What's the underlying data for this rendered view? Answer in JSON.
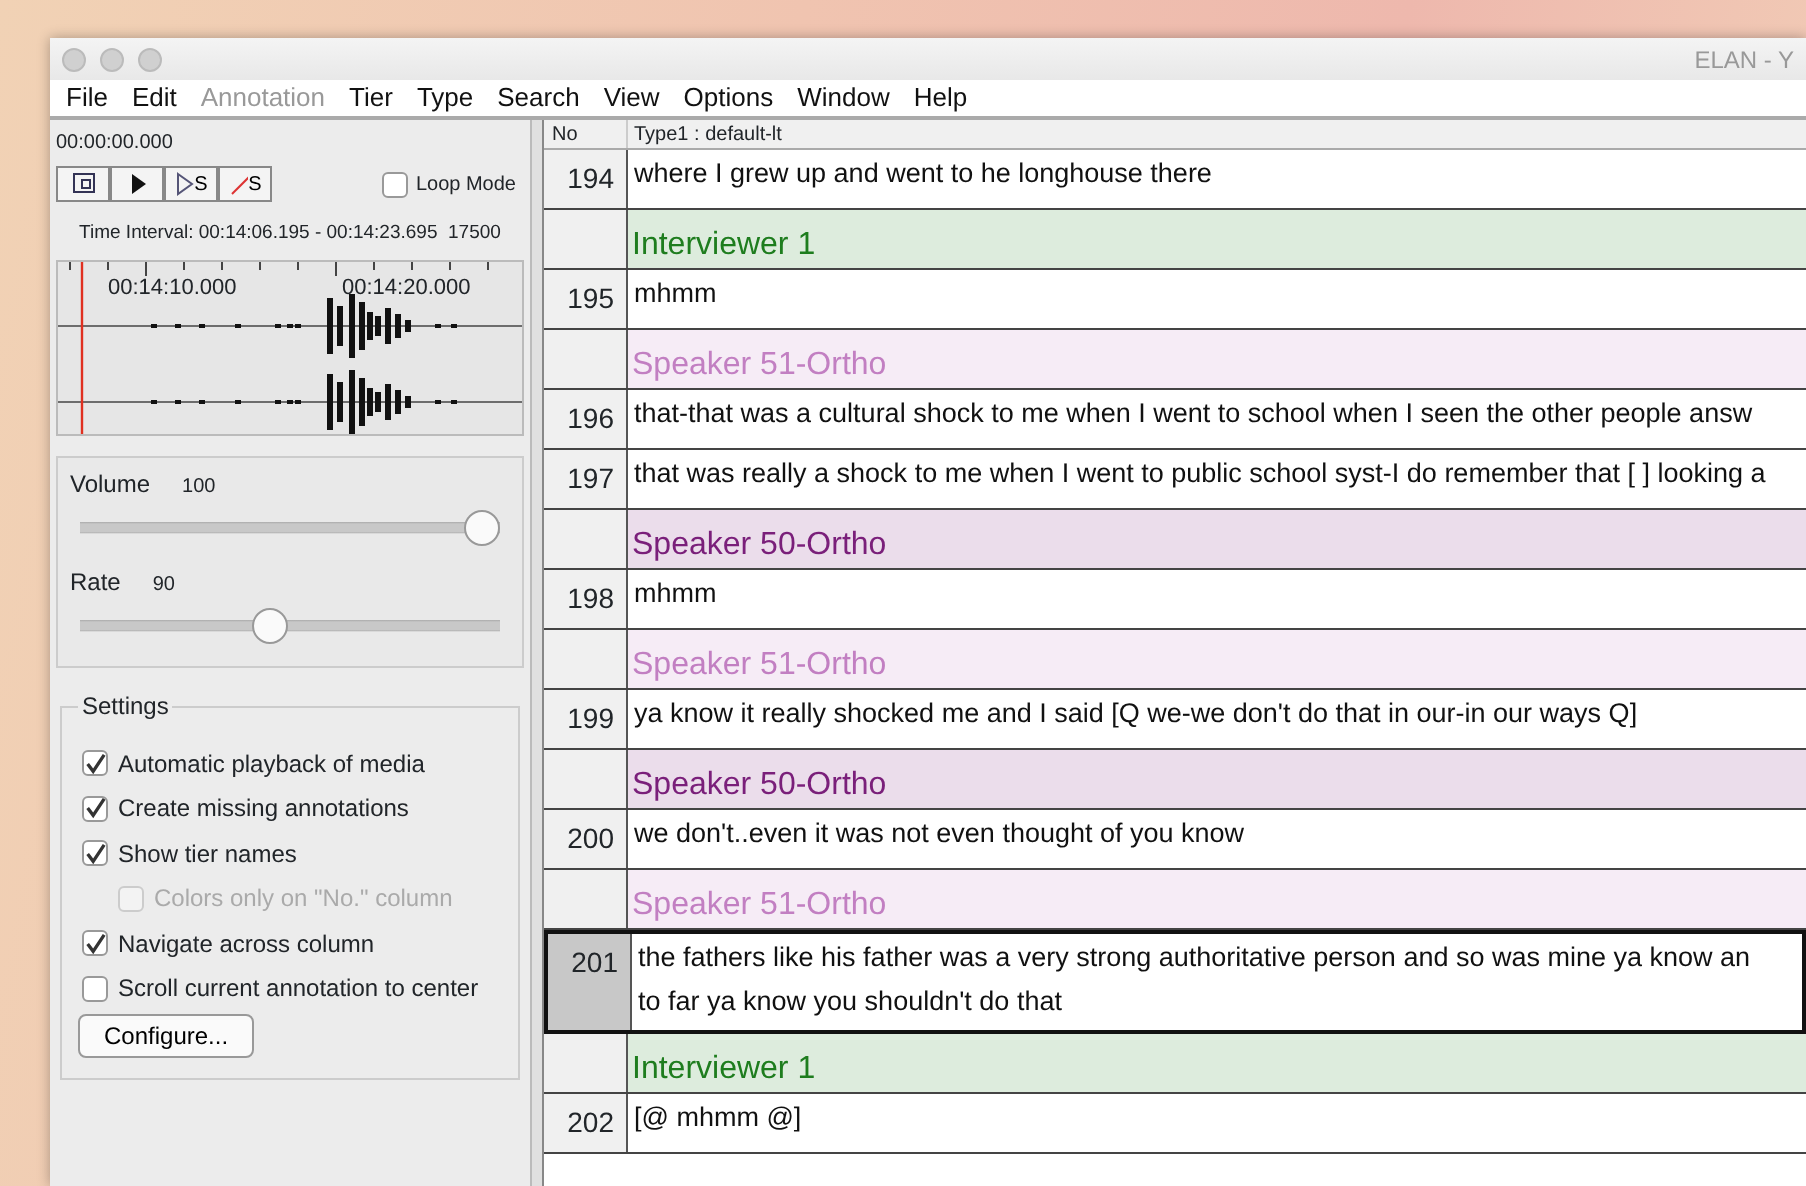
{
  "window": {
    "title": "ELAN - Y"
  },
  "menu": [
    {
      "label": "File",
      "disabled": false
    },
    {
      "label": "Edit",
      "disabled": false
    },
    {
      "label": "Annotation",
      "disabled": true
    },
    {
      "label": "Tier",
      "disabled": false
    },
    {
      "label": "Type",
      "disabled": false
    },
    {
      "label": "Search",
      "disabled": false
    },
    {
      "label": "View",
      "disabled": false
    },
    {
      "label": "Options",
      "disabled": false
    },
    {
      "label": "Window",
      "disabled": false
    },
    {
      "label": "Help",
      "disabled": false
    }
  ],
  "player": {
    "time": "00:00:00.000",
    "buttons": [
      {
        "kind": "selection"
      },
      {
        "kind": "play"
      },
      {
        "kind": "play-selection",
        "label": "S"
      },
      {
        "kind": "clear-selection",
        "label": "S"
      }
    ],
    "loop_mode": {
      "label": "Loop Mode",
      "checked": false
    },
    "time_interval": "Time Interval: 00:14:06.195 - 00:14:23.695  17500",
    "ruler_labels": [
      "00:14:10.000",
      "00:14:20.000"
    ]
  },
  "sliders": [
    {
      "label": "Volume",
      "reading": "100",
      "level": 1.0
    },
    {
      "label": "Rate",
      "reading": "90",
      "level": 0.45
    }
  ],
  "settings": {
    "title": "Settings",
    "options": [
      {
        "label": "Automatic playback of media",
        "checked": true,
        "disabled": false
      },
      {
        "label": "Create missing annotations",
        "checked": true,
        "disabled": false
      },
      {
        "label": "Show tier names",
        "checked": true,
        "disabled": false,
        "children": [
          {
            "label": "Colors only on \"No.\" column",
            "checked": false,
            "disabled": true
          }
        ]
      },
      {
        "label": "Navigate across column",
        "checked": true,
        "disabled": false
      },
      {
        "label": "Scroll current annotation to center",
        "checked": false,
        "disabled": false
      }
    ],
    "button": "Configure..."
  },
  "table": {
    "columns": [
      "No",
      "Type1 : default-lt"
    ],
    "rows": [
      {
        "kind": "annotation",
        "no": "194",
        "text": "where I grew up and went to he longhouse there",
        "selected": false
      },
      {
        "kind": "tier",
        "text": "Interviewer 1",
        "color": "#1e7d1e"
      },
      {
        "kind": "annotation",
        "no": "195",
        "text": "mhmm",
        "selected": false
      },
      {
        "kind": "tier",
        "text": "Speaker 51-Ortho",
        "color": "#c27fc2"
      },
      {
        "kind": "annotation",
        "no": "196",
        "text": "that-that was a cultural shock to me when I went to school when I seen the other people answ",
        "selected": false
      },
      {
        "kind": "annotation",
        "no": "197",
        "text": "that was really a shock to me when I went to public school syst-I do remember that [ ] looking a",
        "selected": false
      },
      {
        "kind": "tier",
        "text": "Speaker 50-Ortho",
        "color": "#7a1f7a"
      },
      {
        "kind": "annotation",
        "no": "198",
        "text": "mhmm",
        "selected": false
      },
      {
        "kind": "tier",
        "text": "Speaker 51-Ortho",
        "color": "#c27fc2"
      },
      {
        "kind": "annotation",
        "no": "199",
        "text": "ya know it really shocked me and I said [Q we-we don't do that in our-in our ways Q]",
        "selected": false
      },
      {
        "kind": "tier",
        "text": "Speaker 50-Ortho",
        "color": "#7a1f7a"
      },
      {
        "kind": "annotation",
        "no": "200",
        "text": "we don't..even it was not even thought of you know",
        "selected": false
      },
      {
        "kind": "tier",
        "text": "Speaker 51-Ortho",
        "color": "#c27fc2"
      },
      {
        "kind": "annotation",
        "no": "201",
        "text": "the fathers like his father was a very strong authoritative person and so was mine ya know an",
        "text_2": "to far ya know you shouldn't do that",
        "selected": true
      },
      {
        "kind": "tier",
        "text": "Interviewer 1",
        "color": "#1e7d1e"
      },
      {
        "kind": "annotation",
        "no": "202",
        "text": "[@ mhmm @]",
        "selected": false
      }
    ]
  }
}
